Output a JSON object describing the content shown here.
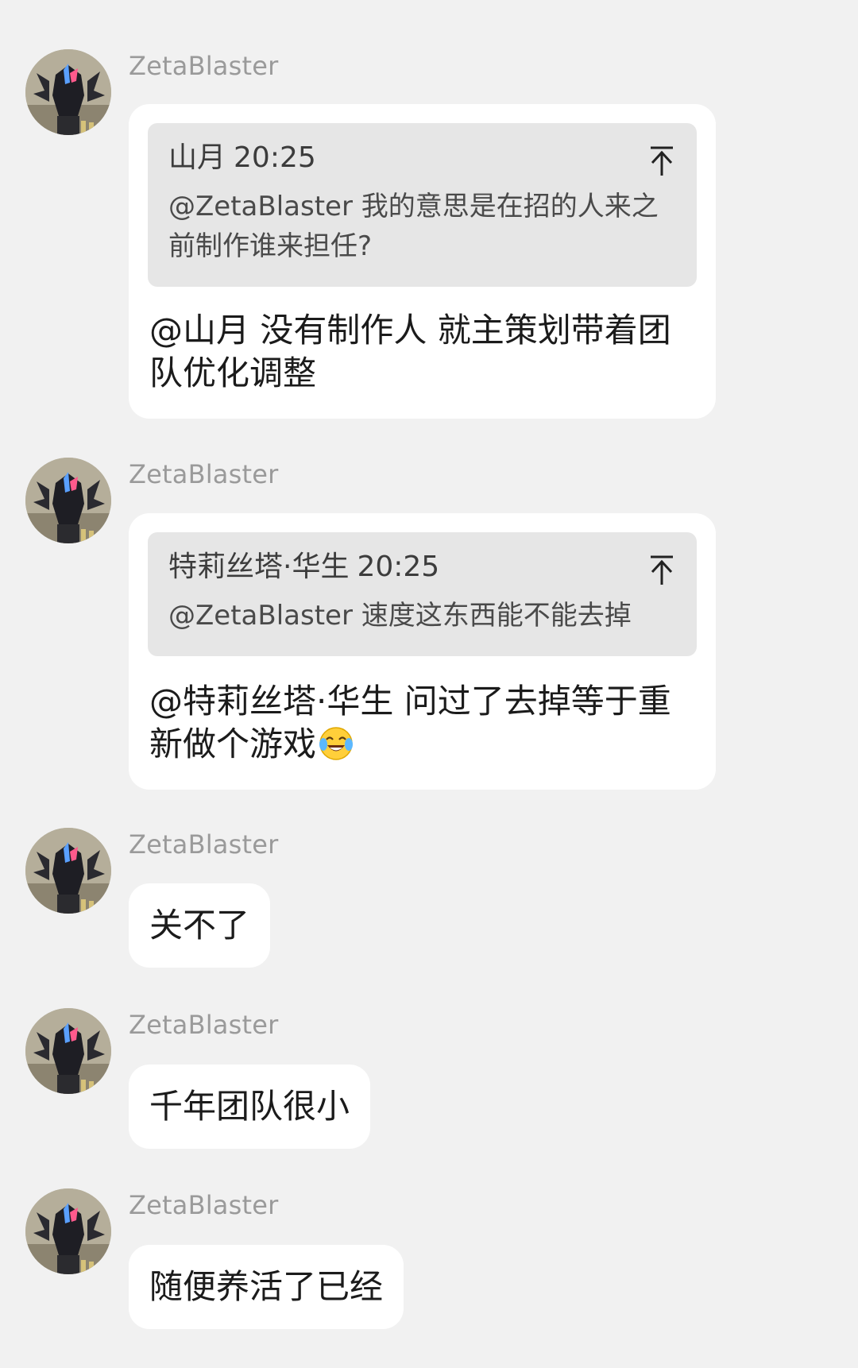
{
  "messages": [
    {
      "sender": "ZetaBlaster",
      "quote": {
        "author": "山月",
        "time": "20:25",
        "text": "@ZetaBlaster 我的意思是在招的人来之前制作谁来担任?"
      },
      "text": "@山月 没有制作人 就主策划带着团队优化调整"
    },
    {
      "sender": "ZetaBlaster",
      "quote": {
        "author": "特莉丝塔·华生",
        "time": "20:25",
        "text": "@ZetaBlaster 速度这东西能不能去掉"
      },
      "text": "@特莉丝塔·华生 问过了去掉等于重新做个游戏",
      "emoji": "tears-of-joy-emoji"
    },
    {
      "sender": "ZetaBlaster",
      "text": "关不了"
    },
    {
      "sender": "ZetaBlaster",
      "text": "千年团队很小"
    },
    {
      "sender": "ZetaBlaster",
      "text": "随便养活了已经"
    }
  ],
  "icons": {
    "avatar": "avatar-armored-hero",
    "quote_jump": "jump-to-top-icon"
  },
  "colors": {
    "background": "#f1f1f1",
    "bubble": "#ffffff",
    "quote_background": "#e6e6e6",
    "sender_name": "#9a9a9a"
  }
}
